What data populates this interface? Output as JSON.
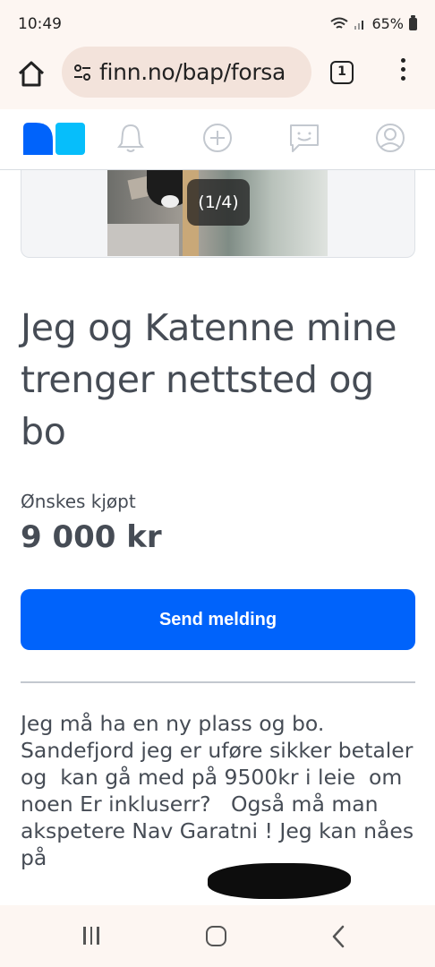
{
  "status_bar": {
    "time": "10:49",
    "battery": "65%"
  },
  "browser": {
    "url": "finn.no/bap/forsa",
    "tab_count": "1"
  },
  "site_nav": {
    "items": [
      "logo",
      "notifications",
      "new-ad",
      "messages",
      "profile"
    ],
    "brand_colors": [
      "#0063fb",
      "#06befb"
    ]
  },
  "gallery": {
    "counter": "(1/4)"
  },
  "ad": {
    "title": "Jeg og Katenne mine trenger nettsted og bo",
    "type_label": "Ønskes kjøpt",
    "price": "9 000 kr"
  },
  "actions": {
    "send_message": "Send melding"
  },
  "description": {
    "text": "Jeg må ha en ny plass og bo. Sandefjord jeg er uføre sikker betaler og  kan gå med på 9500kr i leie  om noen Er inkluserr?   Også må man akspetere Nav Garatni ! Jeg kan nåes på"
  },
  "colors": {
    "accent": "#0063fb",
    "text": "#464c55",
    "chrome": "#fdf6f2"
  }
}
